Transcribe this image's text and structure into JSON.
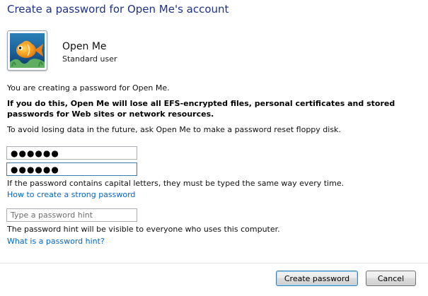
{
  "header": {
    "title": "Create a password for Open Me's account"
  },
  "account": {
    "name": "Open Me",
    "type": "Standard user",
    "picture": "fish-icon"
  },
  "content": {
    "intro": "You are creating a password for Open Me.",
    "warning": "If you do this, Open Me will lose all EFS-encrypted files, personal certificates and stored passwords for Web sites or network resources.",
    "advice": "To avoid losing data in the future, ask Open Me to make a password reset floppy disk.",
    "case_note": "If the password contains capital letters, they must be typed the same way every time.",
    "strong_password_link": "How to create a strong password",
    "hint_note": "The password hint will be visible to everyone who uses this computer.",
    "hint_link": "What is a password hint?"
  },
  "form": {
    "new_password_value": "●●●●●●",
    "confirm_password_value": "●●●●●●",
    "hint_placeholder": "Type a password hint",
    "hint_value": ""
  },
  "buttons": {
    "create_label": "Create password",
    "cancel_label": "Cancel"
  },
  "colors": {
    "title": "#1e3287",
    "link": "#0066cc"
  }
}
